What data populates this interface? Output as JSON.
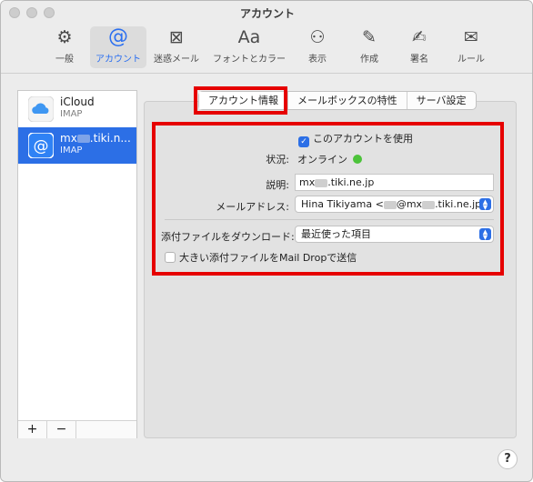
{
  "window": {
    "title": "アカウント"
  },
  "toolbar": {
    "items": [
      {
        "label": "一般",
        "glyph": "⚙",
        "icon": "gear-icon"
      },
      {
        "label": "アカウント",
        "glyph": "@",
        "icon": "at-icon",
        "active": true
      },
      {
        "label": "迷惑メール",
        "glyph": "⊠",
        "icon": "junk-icon"
      },
      {
        "label": "フォントとカラー",
        "glyph": "Aa",
        "icon": "fonts-icon"
      },
      {
        "label": "表示",
        "glyph": "⚇",
        "icon": "glasses-icon"
      },
      {
        "label": "作成",
        "glyph": "✎",
        "icon": "compose-icon"
      },
      {
        "label": "署名",
        "glyph": "✍",
        "icon": "signature-icon"
      },
      {
        "label": "ルール",
        "glyph": "✉",
        "icon": "rules-icon"
      }
    ]
  },
  "accounts": [
    {
      "name": "iCloud",
      "type": "IMAP",
      "icon": "icloud-icon"
    },
    {
      "name_prefix": "mx",
      "name_suffix": ".tiki.n...",
      "type": "IMAP",
      "icon": "at-account-icon",
      "selected": true
    }
  ],
  "list_controls": {
    "add": "+",
    "remove": "−"
  },
  "tabs": [
    "アカウント情報",
    "メールボックスの特性",
    "サーバ設定"
  ],
  "info": {
    "use_account_label": "このアカウントを使用",
    "status_label": "状況:",
    "status_value": "オンライン",
    "description_label": "説明:",
    "description_prefix": "mx",
    "description_suffix": ".tiki.ne.jp",
    "email_label": "メールアドレス:",
    "email_name": "Hina Tikiyama <",
    "email_mid": "@mx",
    "email_end": ".tiki.ne.jp>",
    "download_label": "添付ファイルをダウンロード:",
    "download_value": "最近使った項目",
    "maildrop_label": "大きい添付ファイルをMail Dropで送信"
  },
  "help": "?",
  "colors": {
    "accent": "#2c6fe6",
    "highlight": "#e60000",
    "online": "#4cc33a"
  }
}
